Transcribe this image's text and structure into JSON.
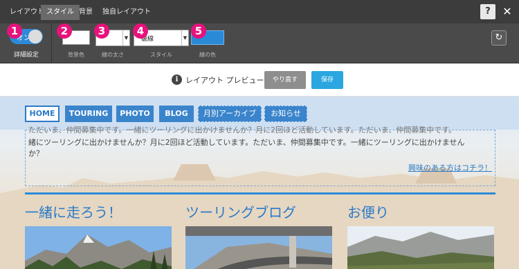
{
  "topbar": {
    "tabs": [
      {
        "label": "レイアウト",
        "active": false
      },
      {
        "label": "スタイル",
        "active": true
      },
      {
        "label": "背景",
        "active": false
      },
      {
        "label": "独自レイアウト",
        "active": false
      }
    ],
    "help_label": "?",
    "close_label": "✕"
  },
  "toolbar": {
    "toggle_on_label": "オン",
    "detail_label": "詳細設定",
    "badges": [
      "1",
      "2",
      "3",
      "4",
      "5"
    ],
    "bg_color_label": "背景色",
    "line_width_label": "線の太さ",
    "style_label": "スタイル",
    "style_value": "破線",
    "line_color_label": "線の色",
    "line_color": "#2a8ad8",
    "reset_icon": "↻"
  },
  "preview": {
    "info_icon": "i",
    "title": "レイアウト  プレビュー",
    "redo_label": "やり直す",
    "save_label": "保存"
  },
  "site": {
    "nav": [
      "HOME",
      "TOURING",
      "PHOTO",
      "BLOG",
      "月別アーカイブ",
      "お知らせ"
    ],
    "text_line1": "ただいま、仲間募集中です。一緒にツーリングに出かけませんか？月に2回ほど活動しています。ただいま、仲間募集中です。",
    "text_line2": "緒にツーリングに出かけませんか？月に2回ほど活動しています。ただいま、仲間募集中です。一緒にツーリングに出かけません",
    "text_line3": "か？",
    "interest_link": "興味のある方はコチラ！",
    "columns": [
      "一緒に走ろう！",
      "ツーリングブログ",
      "お便り"
    ]
  }
}
